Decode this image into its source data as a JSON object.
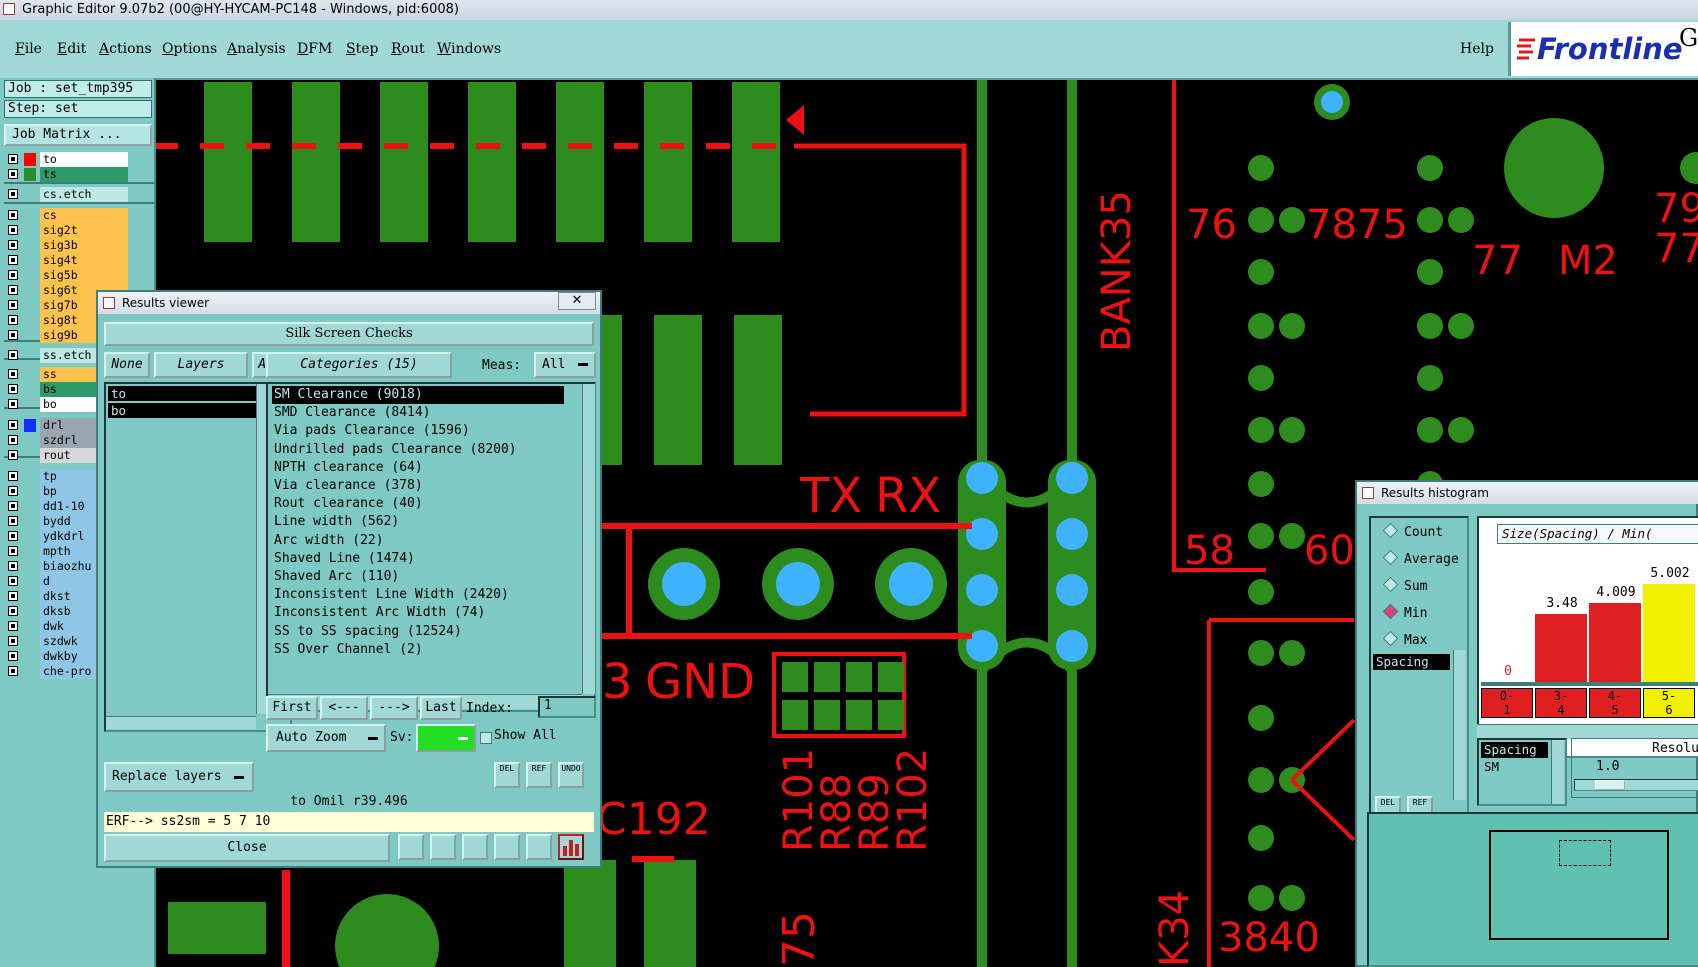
{
  "window": {
    "title": "Graphic Editor 9.07b2 (00@HY-HYCAM-PC148 - Windows, pid:6008)"
  },
  "menubar": {
    "items": [
      "File",
      "Edit",
      "Actions",
      "Options",
      "Analysis",
      "DFM",
      "Step",
      "Rout",
      "Windows"
    ],
    "help": "Help",
    "logo": "Frontline",
    "logo_suffix": "G"
  },
  "left_panel": {
    "job": "Job : set_tmp395",
    "step": "Step: set",
    "job_matrix": "Job Matrix ...",
    "layers": [
      {
        "name": "to",
        "color": "#ffffff",
        "swatch": "#ff0000"
      },
      {
        "name": "ts",
        "color": "#2e9a6a",
        "swatch": "#2e8b2e"
      },
      {
        "name": "cs.etch",
        "color": "#bfe8e5",
        "swatch": ""
      },
      {
        "name": "cs",
        "color": "#ffc34d",
        "swatch": ""
      },
      {
        "name": "sig2t",
        "color": "#ffc34d",
        "swatch": ""
      },
      {
        "name": "sig3b",
        "color": "#ffc34d",
        "swatch": ""
      },
      {
        "name": "sig4t",
        "color": "#ffc34d",
        "swatch": ""
      },
      {
        "name": "sig5b",
        "color": "#ffc34d",
        "swatch": ""
      },
      {
        "name": "sig6t",
        "color": "#ffc34d",
        "swatch": ""
      },
      {
        "name": "sig7b",
        "color": "#ffc34d",
        "swatch": ""
      },
      {
        "name": "sig8t",
        "color": "#ffc34d",
        "swatch": ""
      },
      {
        "name": "sig9b",
        "color": "#ffc34d",
        "swatch": ""
      },
      {
        "name": "ss.etch",
        "color": "#bfe8e5",
        "swatch": ""
      },
      {
        "name": "ss",
        "color": "#ffc34d",
        "swatch": ""
      },
      {
        "name": "bs",
        "color": "#2e9a6a",
        "swatch": ""
      },
      {
        "name": "bo",
        "color": "#ffffff",
        "swatch": ""
      },
      {
        "name": "drl",
        "color": "#9aa6b0",
        "swatch": "#1030ff"
      },
      {
        "name": "szdrl",
        "color": "#9aa6b0",
        "swatch": ""
      },
      {
        "name": "rout",
        "color": "#d8d8d8",
        "swatch": ""
      },
      {
        "name": "tp",
        "color": "#8fc6e6",
        "swatch": ""
      },
      {
        "name": "bp",
        "color": "#8fc6e6",
        "swatch": ""
      },
      {
        "name": "dd1-10",
        "color": "#8fc6e6",
        "swatch": ""
      },
      {
        "name": "bydd",
        "color": "#8fc6e6",
        "swatch": ""
      },
      {
        "name": "ydkdrl",
        "color": "#8fc6e6",
        "swatch": ""
      },
      {
        "name": "mpth",
        "color": "#8fc6e6",
        "swatch": ""
      },
      {
        "name": "biaozhu",
        "color": "#8fc6e6",
        "swatch": ""
      },
      {
        "name": "d",
        "color": "#8fc6e6",
        "swatch": ""
      },
      {
        "name": "dkst",
        "color": "#8fc6e6",
        "swatch": ""
      },
      {
        "name": "dksb",
        "color": "#8fc6e6",
        "swatch": ""
      },
      {
        "name": "dwk",
        "color": "#8fc6e6",
        "swatch": ""
      },
      {
        "name": "szdwk",
        "color": "#8fc6e6",
        "swatch": ""
      },
      {
        "name": "dwkby",
        "color": "#8fc6e6",
        "swatch": ""
      },
      {
        "name": "che-pro",
        "color": "#8fc6e6",
        "swatch": ""
      }
    ]
  },
  "results_viewer": {
    "title": "Results viewer",
    "header": "Silk Screen Checks",
    "none_btn": "None",
    "layers_btn": "Layers",
    "all_btn": "All",
    "layer_list": [
      "to",
      "bo"
    ],
    "categories_btn": "Categories (15)",
    "meas_label": "Meas:",
    "meas_value": "All",
    "categories": [
      "SM Clearance (9018)",
      "SMD Clearance (8414)",
      "Via pads Clearance (1596)",
      "Undrilled pads Clearance (8200)",
      "NPTH clearance (64)",
      "Via clearance (378)",
      "Rout clearance (40)",
      "Line width (562)",
      "Arc width (22)",
      "Shaved Line (1474)",
      "Shaved Arc (110)",
      "Inconsistent Line Width (2420)",
      "Inconsistent Arc Width (74)",
      "SS to SS spacing (12524)",
      "SS Over Channel (2)"
    ],
    "nav": {
      "first": "First",
      "prev": "<---",
      "next": "--->",
      "last": "Last",
      "index_label": "Index:",
      "index_value": "1"
    },
    "auto_zoom": "Auto Zoom",
    "sv_label": "Sv:",
    "show_all": "Show All",
    "replace_layers": "Replace layers",
    "tool_labels": [
      "DEL",
      "REF",
      "UNDO"
    ],
    "status": "to  Omil  r39.496",
    "erf": "ERF--> ss2sm = 5 7 10",
    "close": "Close"
  },
  "histogram": {
    "title": "Results histogram",
    "modes": [
      "Count",
      "Average",
      "Sum",
      "Min",
      "Max"
    ],
    "selected_mode": "Min",
    "list_items": [
      "Spacing"
    ],
    "tool_labels": [
      "DEL",
      "REF"
    ],
    "chart_header": "Size(Spacing) / Min(",
    "bars": [
      {
        "label": "0-\n1",
        "value": "0",
        "color": "#e02020"
      },
      {
        "label": "3-\n4",
        "value": "3.48",
        "color": "#e02020"
      },
      {
        "label": "4-\n5",
        "value": "4.009",
        "color": "#e02020"
      },
      {
        "label": "5-\n6",
        "value": "5.002",
        "color": "#f0f000"
      }
    ],
    "lower_list": [
      "Spacing",
      "SM"
    ],
    "resolution_label": "Resolu",
    "resolution_value": "1.0"
  },
  "pcb": {
    "labels": [
      "76",
      "7875",
      "77",
      "M2",
      "79",
      "77",
      "BANK35",
      "TX",
      "RX",
      "58",
      "60",
      "GND",
      "R101",
      "R88",
      "R89",
      "R102",
      "C192",
      "3",
      "75",
      "K34",
      "3840"
    ]
  }
}
